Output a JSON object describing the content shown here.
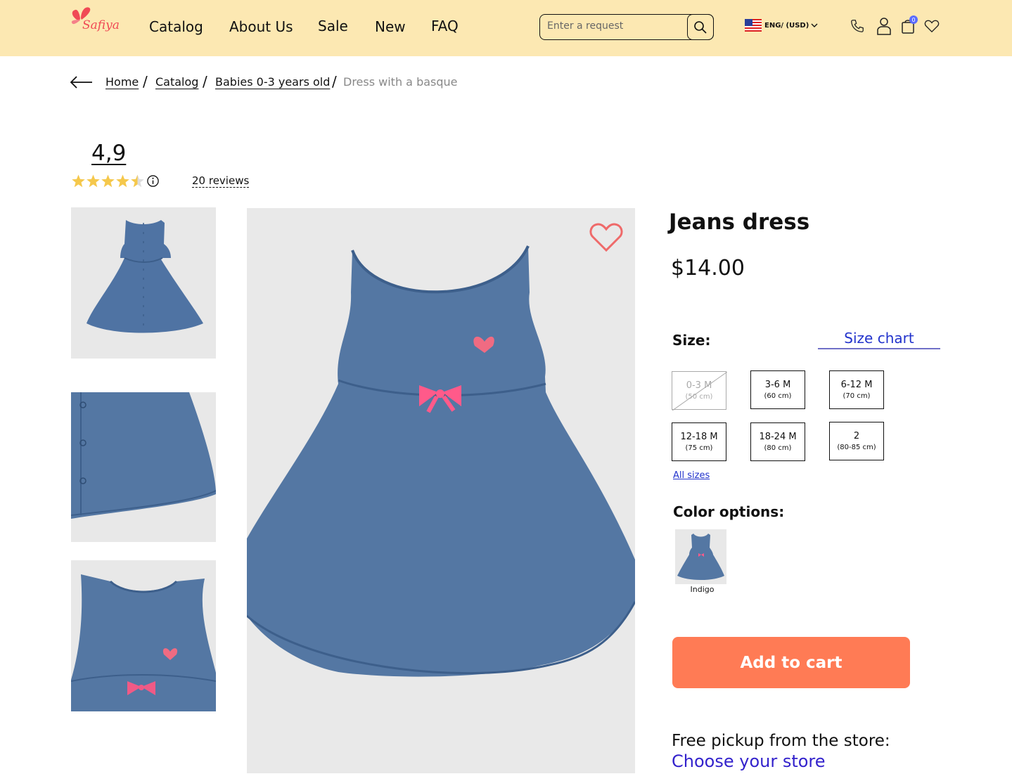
{
  "header": {
    "logo_text": "Safiya",
    "nav": [
      "Catalog",
      "About Us",
      "Sale",
      "New",
      "FAQ"
    ],
    "search": {
      "placeholder": "Enter a request"
    },
    "language": "ENG/ (USD)",
    "cart_count": "0",
    "background": "#fce8b2"
  },
  "breadcrumb": {
    "items": [
      "Home",
      "Catalog",
      "Babies 0-3 years old"
    ],
    "current": "Dress with a basque"
  },
  "rating": {
    "value": "4,9",
    "stars": 4.5,
    "reviews": "20 reviews",
    "star_color": "#f5c84c"
  },
  "product": {
    "title": "Jeans dress",
    "price": "$14.00",
    "size_label": "Size:",
    "size_chart": "Size chart",
    "sizes": [
      {
        "size": "0-3 M",
        "cm": "(50 cm)",
        "available": false
      },
      {
        "size": "3-6 M",
        "cm": "(60 cm)",
        "available": true
      },
      {
        "size": "6-12 M",
        "cm": "(70 cm)",
        "available": true
      },
      {
        "size": "12-18 M",
        "cm": "(75 cm)",
        "available": true
      },
      {
        "size": "18-24 M",
        "cm": "(80 cm)",
        "available": true
      },
      {
        "size": "2",
        "cm": "(80-85 cm)",
        "available": true
      }
    ],
    "all_sizes": "All sizes",
    "color_label": "Color options:",
    "color_name": "Indigo",
    "add_to_cart": "Add to cart",
    "pickup_text": "Free pickup from the store:",
    "choose_store": "Choose your store",
    "accent_color": "#ff7b55",
    "denim_color": "#5477a3"
  }
}
